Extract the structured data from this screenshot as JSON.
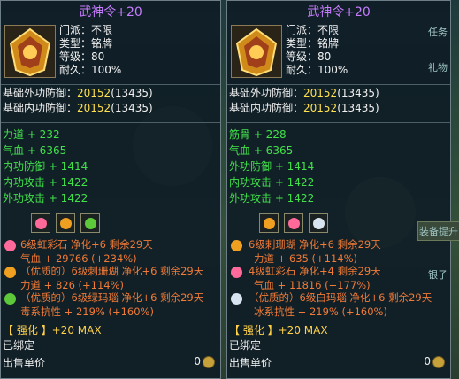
{
  "left": {
    "title": "武神令+20",
    "info": {
      "sect": "门派：不限",
      "type": "类型：铭牌",
      "level": "等级：80",
      "durability": "耐久：100%"
    },
    "base_outer_label": "基础外功防御：",
    "base_outer_value": "20152",
    "base_outer_extra": "(13435)",
    "base_inner_label": "基础内功防御：",
    "base_inner_value": "20152",
    "base_inner_extra": "(13435)",
    "stats": [
      "力道 + 232",
      "气血 + 6365",
      "内功防御 + 1414",
      "内功攻击 + 1422",
      "外功攻击 + 1422"
    ],
    "gems": [
      {
        "line1": "6级虹彩石 净化+6 剩余29天",
        "line2": "气血 + 29766 (+234%)",
        "color": "#ff6a9a"
      },
      {
        "line1": "（优质的）6级刺珊瑚 净化+6 剩余29天",
        "line2": "力道 + 826 (+114%)",
        "color": "#f0a020"
      },
      {
        "line1": "（优质的）6级绿玛瑙 净化+6 剩余29天",
        "line2": "毒系抗性 + 219% (+160%)",
        "color": "#5cc83a"
      }
    ],
    "strength": "【 强化 】+20 MAX",
    "bound": "已绑定",
    "price_label": "出售单价",
    "price_value": "0"
  },
  "right": {
    "title": "武神令+20",
    "info": {
      "sect": "门派：不限",
      "type": "类型：铭牌",
      "level": "等级：80",
      "durability": "耐久：100%"
    },
    "base_outer_label": "基础外功防御：",
    "base_outer_value": "20152",
    "base_outer_extra": "(13435)",
    "base_inner_label": "基础内功防御：",
    "base_inner_value": "20152",
    "base_inner_extra": "(13435)",
    "stats": [
      "筋骨 + 228",
      "气血 + 6365",
      "外功防御 + 1414",
      "内功攻击 + 1422",
      "外功攻击 + 1422"
    ],
    "gems": [
      {
        "line1": "6级刺珊瑚 净化+6 剩余29天",
        "line2": "力道 + 635 (+114%)",
        "color": "#f0a020"
      },
      {
        "line1": "4级虹彩石 净化+4 剩余29天",
        "line2": "气血 + 11816 (+177%)",
        "color": "#ff6a9a"
      },
      {
        "line1": "（优质的）6级白玛瑙 净化+6 剩余29天",
        "line2": "冰系抗性 + 219% (+160%)",
        "color": "#d8e4f0"
      }
    ],
    "strength": "【 强化 】+20 MAX",
    "bound": "已绑定",
    "price_label": "出售单价",
    "price_value": "0"
  },
  "sidebar": {
    "task": "任务",
    "gift": "礼物",
    "equip": "装备提升",
    "silver": "银子"
  }
}
